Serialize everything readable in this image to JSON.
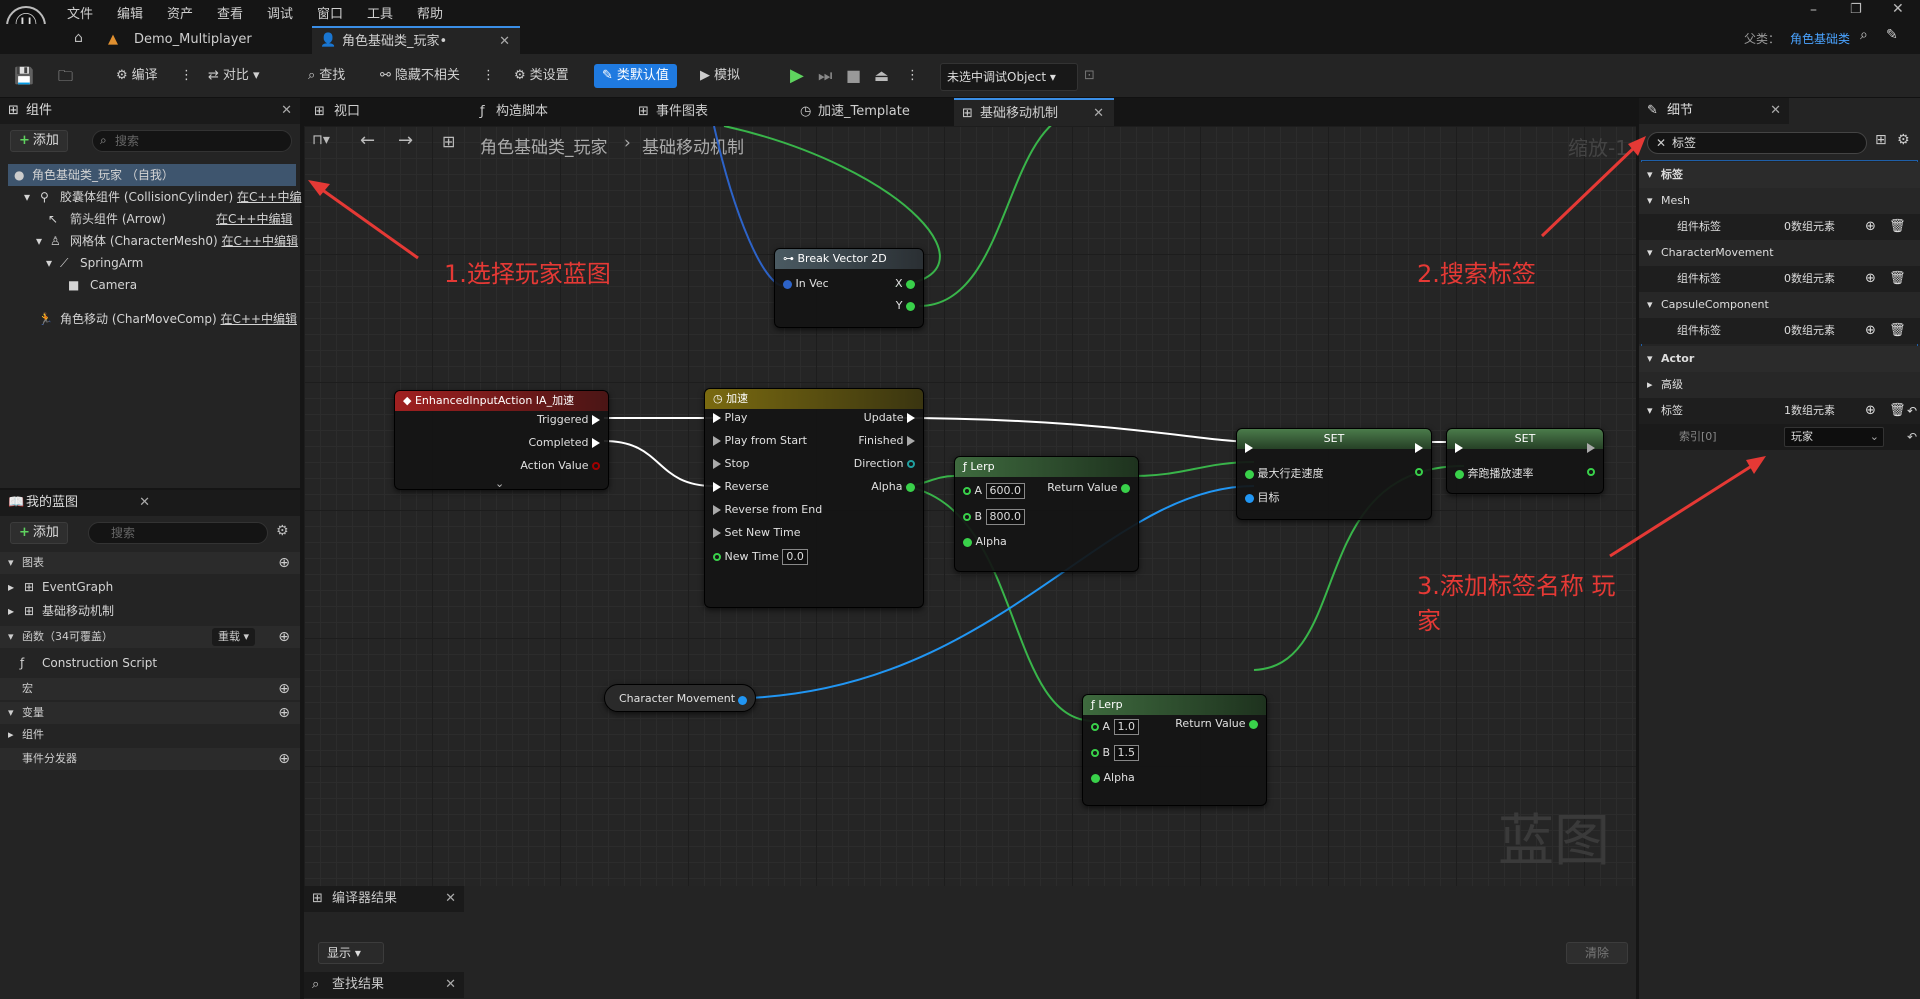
{
  "menu": [
    "文件",
    "编辑",
    "资产",
    "查看",
    "调试",
    "窗口",
    "工具",
    "帮助"
  ],
  "tabs": {
    "project": "Demo_Multiplayer",
    "blueprint": "角色基础类_玩家•"
  },
  "parent": {
    "label": "父类：",
    "value": "角色基础类"
  },
  "toolbar": {
    "compile": "编译",
    "diff": "对比",
    "find": "查找",
    "hide": "隐藏不相关",
    "class_settings": "类设置",
    "class_defaults": "类默认值",
    "simulate": "模拟",
    "debug_object": "未选中调试Object"
  },
  "components": {
    "title": "组件",
    "add": "添加",
    "search": "搜索",
    "items": [
      {
        "label": "角色基础类_玩家 （自我）",
        "link": ""
      },
      {
        "label": "胶囊体组件 (CollisionCylinder)",
        "link": "在C++中编"
      },
      {
        "label": "箭头组件 (Arrow)",
        "link": "在C++中编辑"
      },
      {
        "label": "网格体 (CharacterMesh0)",
        "link": "在C++中编辑"
      },
      {
        "label": "SpringArm",
        "link": ""
      },
      {
        "label": "Camera",
        "link": ""
      },
      {
        "label": "角色移动 (CharMoveComp)",
        "link": "在C++中编辑"
      }
    ]
  },
  "my_blueprint": {
    "title": "我的蓝图",
    "add": "添加",
    "search": "搜索",
    "graphs_label": "图表",
    "graphs": [
      "EventGraph",
      "基础移动机制"
    ],
    "functions_label": "函数（34可覆盖）",
    "override": "重载",
    "construction": "Construction Script",
    "macros": "宏",
    "variables": "变量",
    "var_components": "组件",
    "dispatchers": "事件分发器"
  },
  "graph_tabs": [
    "视口",
    "构造脚本",
    "事件图表",
    "加速_Template",
    "基础移动机制"
  ],
  "breadcrumb": {
    "root": "角色基础类_玩家",
    "child": "基础移动机制"
  },
  "zoom": "缩放-1",
  "watermark": "蓝图",
  "nodes": {
    "break": {
      "title": "Break Vector 2D",
      "in": "In Vec",
      "x": "X",
      "y": "Y"
    },
    "input": {
      "title": "EnhancedInputAction IA_加速",
      "triggered": "Triggered",
      "completed": "Completed",
      "value": "Action Value"
    },
    "timeline": {
      "title": "加速",
      "pins_in": [
        "Play",
        "Play from Start",
        "Stop",
        "Reverse",
        "Reverse from End",
        "Set New Time",
        "New Time"
      ],
      "new_time": "0.0",
      "update": "Update",
      "finished": "Finished",
      "direction": "Direction",
      "alpha": "Alpha"
    },
    "lerp1": {
      "title": "Lerp",
      "a_label": "A",
      "a": "600.0",
      "b_label": "B",
      "b": "800.0",
      "alpha": "Alpha",
      "ret": "Return Value"
    },
    "lerp2": {
      "title": "Lerp",
      "a_label": "A",
      "a": "1.0",
      "b_label": "B",
      "b": "1.5",
      "alpha": "Alpha",
      "ret": "Return Value"
    },
    "set1": {
      "title": "SET",
      "p1": "最大行走速度",
      "p2": "目标"
    },
    "set2": {
      "title": "SET",
      "p1": "奔跑播放速率"
    },
    "charmove": {
      "title": "Character Movement"
    }
  },
  "details": {
    "title": "细节",
    "search": "标签",
    "rows": [
      {
        "label": "标签",
        "type": "section"
      },
      {
        "label": "Mesh",
        "type": "cat"
      },
      {
        "label": "组件标签",
        "value": "0数组元素",
        "type": "prop"
      },
      {
        "label": "CharacterMovement",
        "type": "cat"
      },
      {
        "label": "组件标签",
        "value": "0数组元素",
        "type": "prop"
      },
      {
        "label": "CapsuleComponent",
        "type": "cat"
      },
      {
        "label": "组件标签",
        "value": "0数组元素",
        "type": "prop"
      },
      {
        "label": "Actor",
        "type": "section"
      },
      {
        "label": "高级",
        "type": "cat"
      },
      {
        "label": "标签",
        "value": "1数组元素",
        "type": "prop"
      },
      {
        "label": "索引[0]",
        "value": "玩家",
        "type": "index"
      }
    ]
  },
  "annotations": [
    "1.选择玩家蓝图",
    "2.搜索标签",
    "3.添加标签名称 玩家"
  ],
  "compiler": {
    "title": "编译器结果",
    "show": "显示",
    "clear": "清除"
  },
  "find_results": "查找结果",
  "colors": {
    "accent": "#1f7ae0",
    "annotation": "#e53935",
    "exec": "#ffffff",
    "float": "#5fd35f",
    "object": "#2196f3"
  }
}
